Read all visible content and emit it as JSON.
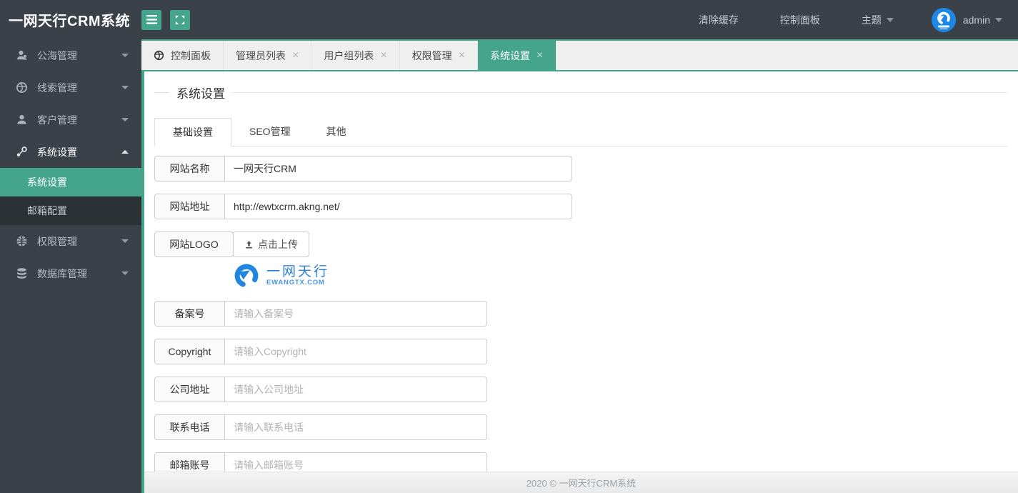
{
  "app": {
    "title": "一网天行CRM系统"
  },
  "header": {
    "cache_link": "清除缓存",
    "dashboard_link": "控制面板",
    "theme_label": "主题",
    "username": "admin"
  },
  "sidebar": {
    "items": [
      {
        "label": "公海管理",
        "icon": "users-icon"
      },
      {
        "label": "线索管理",
        "icon": "globe-icon"
      },
      {
        "label": "客户管理",
        "icon": "user-icon"
      },
      {
        "label": "系统设置",
        "icon": "settings-nodes-icon",
        "expanded": true
      },
      {
        "label": "权限管理",
        "icon": "globe-grid-icon"
      },
      {
        "label": "数据库管理",
        "icon": "database-icon"
      }
    ],
    "submenu": [
      {
        "label": "系统设置",
        "active": true
      },
      {
        "label": "邮箱配置",
        "active": false
      }
    ]
  },
  "tabbar": {
    "close_glyph": "×",
    "tabs": [
      {
        "label": "控制面板",
        "closable": false,
        "active": false
      },
      {
        "label": "管理员列表",
        "closable": true,
        "active": false
      },
      {
        "label": "用户组列表",
        "closable": true,
        "active": false
      },
      {
        "label": "权限管理",
        "closable": true,
        "active": false
      },
      {
        "label": "系统设置",
        "closable": true,
        "active": true
      }
    ]
  },
  "main": {
    "panel_title": "系统设置",
    "tabs": [
      {
        "label": "基础设置",
        "active": true
      },
      {
        "label": "SEO管理",
        "active": false
      },
      {
        "label": "其他",
        "active": false
      }
    ],
    "fields": {
      "site_name": {
        "label": "网站名称",
        "value": "一网天行CRM"
      },
      "site_url": {
        "label": "网站地址",
        "value": "http://ewtxcrm.akng.net/"
      },
      "site_logo": {
        "label": "网站LOGO",
        "button": "点击上传"
      },
      "icp": {
        "label": "备案号",
        "placeholder": "请输入备案号"
      },
      "copyright": {
        "label": "Copyright",
        "placeholder": "请输入Copyright"
      },
      "address": {
        "label": "公司地址",
        "placeholder": "请输入公司地址"
      },
      "phone": {
        "label": "联系电话",
        "placeholder": "请输入联系电话"
      },
      "email": {
        "label": "邮箱账号",
        "placeholder": "请输入邮箱账号"
      }
    },
    "logo_preview": {
      "title": "一网天行",
      "domain": "EWANGTX.COM"
    }
  },
  "footer": {
    "text": "2020 ©  一网天行CRM系统"
  },
  "colors": {
    "accent_teal": "#44a48c",
    "header_bg": "#3a4149",
    "sidebar_bg": "#3a4149",
    "submenu_bg": "#2c3136",
    "avatar_blue": "#1e88e5",
    "logo_blue": "#2186e0",
    "logo_text_blue": "#2b7fd6"
  }
}
